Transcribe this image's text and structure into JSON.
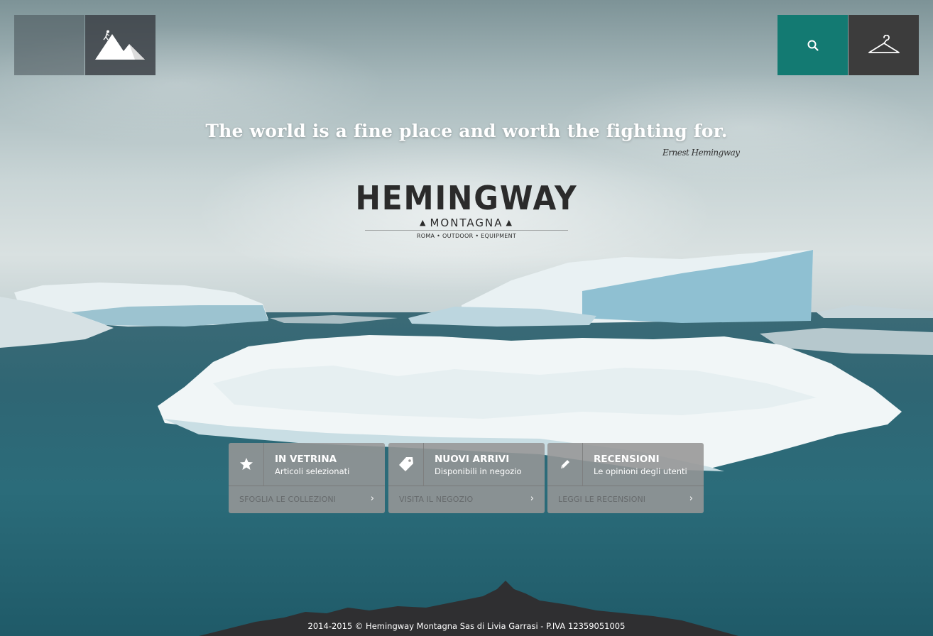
{
  "quote": {
    "text": "The world is a fine place and worth the fighting for.",
    "signature": "Ernest Hemingway"
  },
  "brand": {
    "name": "HEMINGWAY",
    "sub": "MONTAGNA",
    "tagline": "ROMA • OUTDOOR • EQUIPMENT"
  },
  "header": {
    "logo_icon": "mountain-climber-icon",
    "search_icon": "search-icon",
    "cart_icon": "hanger-icon",
    "search_color": "#137a72"
  },
  "cards": [
    {
      "icon": "star-icon",
      "title": "IN VETRINA",
      "desc": "Articoli selezionati",
      "link": "SFOGLIA LE COLLEZIONI",
      "chevron": "›"
    },
    {
      "icon": "tag-icon",
      "title": "NUOVI ARRIVI",
      "desc": "Disponibili in negozio",
      "link": "VISITA IL NEGOZIO",
      "chevron": "›"
    },
    {
      "icon": "pencil-icon",
      "title": "RECENSIONI",
      "desc": "Le opinioni degli utenti",
      "link": "LEGGI LE RECENSIONI",
      "chevron": "›"
    }
  ],
  "footer": {
    "text": "2014-2015 © Hemingway Montagna Sas di Livia Garrasi - P.IVA 12359051005"
  }
}
